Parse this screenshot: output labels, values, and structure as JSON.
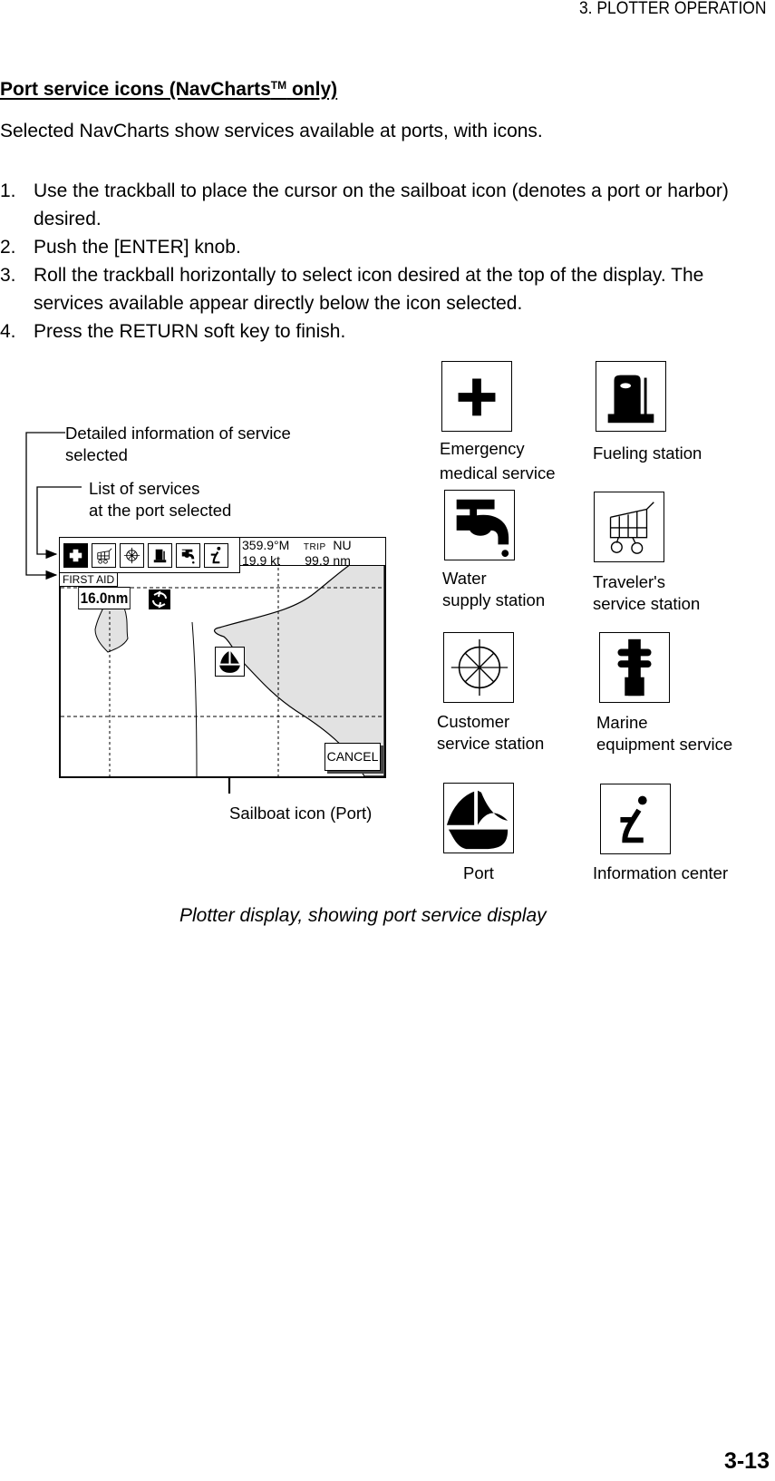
{
  "header": {
    "running_head": "3. PLOTTER OPERATION"
  },
  "section": {
    "title": "Port service icons (NavCharts",
    "title_tm": "TM",
    "title_suffix": " only)",
    "intro": "Selected NavCharts show services available at ports, with icons."
  },
  "steps": [
    {
      "num": "1.",
      "text": "Use the trackball to place the cursor on the sailboat icon (denotes a port or harbor) desired."
    },
    {
      "num": "2.",
      "text": "Push the [ENTER] knob."
    },
    {
      "num": "3.",
      "text": "Roll the trackball horizontally to select icon desired at the top of the display. The services available appear directly below the icon selected."
    },
    {
      "num": "4.",
      "text": "Press the RETURN soft key to finish."
    }
  ],
  "figure": {
    "callouts": {
      "detail_info_line1": "Detailed information of service",
      "detail_info_line2": "selected",
      "service_list_line1": "List of services",
      "service_list_line2": "at the port selected",
      "sailboat": "Sailboat icon (Port)"
    },
    "plotter": {
      "service_icons": [
        "first-aid",
        "shopping-cart",
        "customer-service",
        "fuel",
        "water-tap",
        "information"
      ],
      "selected_service": "first-aid",
      "selected_service_label": "FIRST AID",
      "heading": "359.9°M",
      "trip_label": "TRIP",
      "mode": "NU",
      "speed": "19.9 kt",
      "trip_distance": "99.9 nm",
      "range": "16.0nm",
      "cancel_label": "CANCEL"
    },
    "legend": [
      {
        "icon": "medical-cross-icon",
        "line1": "Emergency",
        "line2": "medical service"
      },
      {
        "icon": "fuel-pump-icon",
        "line1": "Fueling station",
        "line2": ""
      },
      {
        "icon": "water-tap-icon",
        "line1": "Water",
        "line2": "supply station"
      },
      {
        "icon": "shopping-cart-icon",
        "line1": "Traveler's",
        "line2": "service station"
      },
      {
        "icon": "ship-wheel-icon",
        "line1": "Customer",
        "line2": "service station"
      },
      {
        "icon": "marine-equipment-icon",
        "line1": "Marine",
        "line2": "equipment service"
      },
      {
        "icon": "sailboat-icon",
        "line1": "Port",
        "line2": ""
      },
      {
        "icon": "information-icon",
        "line1": "Information center",
        "line2": ""
      }
    ],
    "caption": "Plotter display, showing port service display"
  },
  "footer": {
    "page_number": "3-13"
  }
}
